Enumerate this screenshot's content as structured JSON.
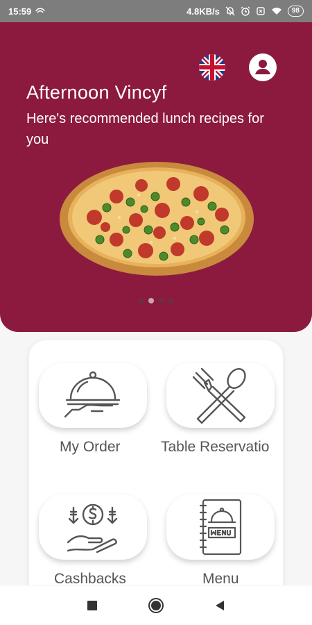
{
  "status_bar": {
    "time": "15:59",
    "network_speed": "4.8KB/s",
    "battery": "98"
  },
  "hero": {
    "greeting": "Afternoon Vincyf",
    "subtitle": "Here's recommended lunch recipes for you",
    "background_color": "#8c1a3e",
    "carousel_dots": 4,
    "active_dot": 1
  },
  "menu_tiles": [
    {
      "label": "My Order",
      "icon": "serving-cloche-icon"
    },
    {
      "label": "Table Reservatio",
      "icon": "fork-spoon-icon"
    },
    {
      "label": "Cashbacks",
      "icon": "cashback-icon"
    },
    {
      "label": "Menu",
      "icon": "menu-book-icon"
    }
  ]
}
